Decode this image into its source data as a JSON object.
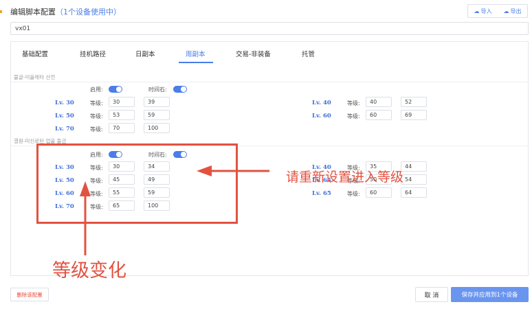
{
  "header": {
    "title": "编辑脚本配置",
    "subtitle": "（1个设备使用中）",
    "import_label": "导入",
    "export_label": "导出"
  },
  "script_name": "vx01",
  "tabs": [
    "基础配置",
    "挂机路径",
    "日副本",
    "周副本",
    "交易-非装备",
    "托管"
  ],
  "active_tab": "周副本",
  "section1": {
    "title": "불굴-이올레타 산전",
    "enable_label": "启用:",
    "timestone_label": "时间石:",
    "enabled": true,
    "timestone": true,
    "rows_left": [
      {
        "lv": "Lv. 30",
        "grade_label": "等级:",
        "v1": "30",
        "v2": "39"
      },
      {
        "lv": "Lv. 50",
        "grade_label": "等级:",
        "v1": "53",
        "v2": "59"
      },
      {
        "lv": "Lv. 70",
        "grade_label": "等级:",
        "v1": "70",
        "v2": "100"
      }
    ],
    "rows_right": [
      {
        "lv": "Lv. 40",
        "grade_label": "等级:",
        "v1": "40",
        "v2": "52"
      },
      {
        "lv": "Lv. 60",
        "grade_label": "等级:",
        "v1": "60",
        "v2": "69"
      }
    ]
  },
  "section2": {
    "title": "결원-미신로탄 업을 돌금",
    "enable_label": "启用:",
    "timestone_label": "时间石:",
    "enabled": true,
    "timestone": true,
    "rows_left": [
      {
        "lv": "Lv. 30",
        "grade_label": "等级:",
        "v1": "30",
        "v2": "34"
      },
      {
        "lv": "Lv. 50",
        "grade_label": "等级:",
        "v1": "45",
        "v2": "49"
      },
      {
        "lv": "Lv. 60",
        "grade_label": "等级:",
        "v1": "55",
        "v2": "59"
      },
      {
        "lv": "Lv. 70",
        "grade_label": "等级:",
        "v1": "65",
        "v2": "100"
      }
    ],
    "rows_right": [
      {
        "lv": "Lv. 40",
        "grade_label": "等级:",
        "v1": "35",
        "v2": "44"
      },
      {
        "lv": "Lv. 65",
        "grade_label": "等级:",
        "v1": "50",
        "v2": "54"
      },
      {
        "lv": "Lv. 65",
        "grade_label": "等级:",
        "v1": "60",
        "v2": "64"
      }
    ]
  },
  "footer": {
    "delete_label": "删除该配置",
    "cancel_label": "取 消",
    "save_label": "保存并应用到1个设备"
  },
  "annotations": {
    "text1": "请重新设置进入等级",
    "text2": "等级变化",
    "color": "#e25241"
  },
  "colors": {
    "accent": "#4a7ee8",
    "level_label": "#3e6fd8",
    "danger": "#e74c3c"
  }
}
